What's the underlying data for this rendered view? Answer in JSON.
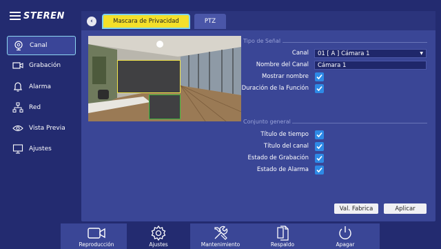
{
  "brand": {
    "logo_text": "STEREN"
  },
  "sidebar": {
    "items": [
      {
        "label": "Canal",
        "icon": "camera-icon",
        "active": true
      },
      {
        "label": "Grabación",
        "icon": "video-icon",
        "active": false
      },
      {
        "label": "Alarma",
        "icon": "bell-icon",
        "active": false
      },
      {
        "label": "Red",
        "icon": "network-icon",
        "active": false
      },
      {
        "label": "Vista Previa",
        "icon": "eye-icon",
        "active": false
      },
      {
        "label": "Ajustes",
        "icon": "monitor-icon",
        "active": false
      }
    ]
  },
  "tabs": [
    {
      "label": "Mascara de Privacidad",
      "active": true
    },
    {
      "label": "PTZ",
      "active": false
    }
  ],
  "signal_section": {
    "title": "Tipo de Señal",
    "canal_label": "Canal",
    "canal_value": "01 [ A ] Cámara 1",
    "nombre_label": "Nombre del Canal",
    "nombre_value": "Cámara 1",
    "mostrar_label": "Mostrar nombre",
    "mostrar_checked": true,
    "duracion_label": "Duración de la Función",
    "duracion_checked": true
  },
  "general_section": {
    "title": "Conjunto general",
    "items": [
      {
        "label": "Título de tiempo",
        "checked": true
      },
      {
        "label": "Título del canal",
        "checked": true
      },
      {
        "label": "Estado de Grabación",
        "checked": true
      },
      {
        "label": "Estado de Alarma",
        "checked": true
      }
    ]
  },
  "buttons": {
    "default_label": "Val. Fabrica",
    "apply_label": "Aplicar"
  },
  "bottom_nav": [
    {
      "label": "Reproducción",
      "icon": "camera-outline-icon",
      "active": false
    },
    {
      "label": "Ajustes",
      "icon": "gear-icon",
      "active": true
    },
    {
      "label": "Mantenimiento",
      "icon": "tools-icon",
      "active": false
    },
    {
      "label": "Respaldo",
      "icon": "files-icon",
      "active": false
    },
    {
      "label": "Apagar",
      "icon": "power-icon",
      "active": false
    }
  ],
  "colors": {
    "background": "#232b70",
    "panel": "#3a4696",
    "active_tab": "#f4e02a",
    "highlight_border": "#8fd8f2",
    "checkbox": "#2e8ae6",
    "mask_yellow": "#f3e64a",
    "mask_green": "#3fbf3f"
  }
}
